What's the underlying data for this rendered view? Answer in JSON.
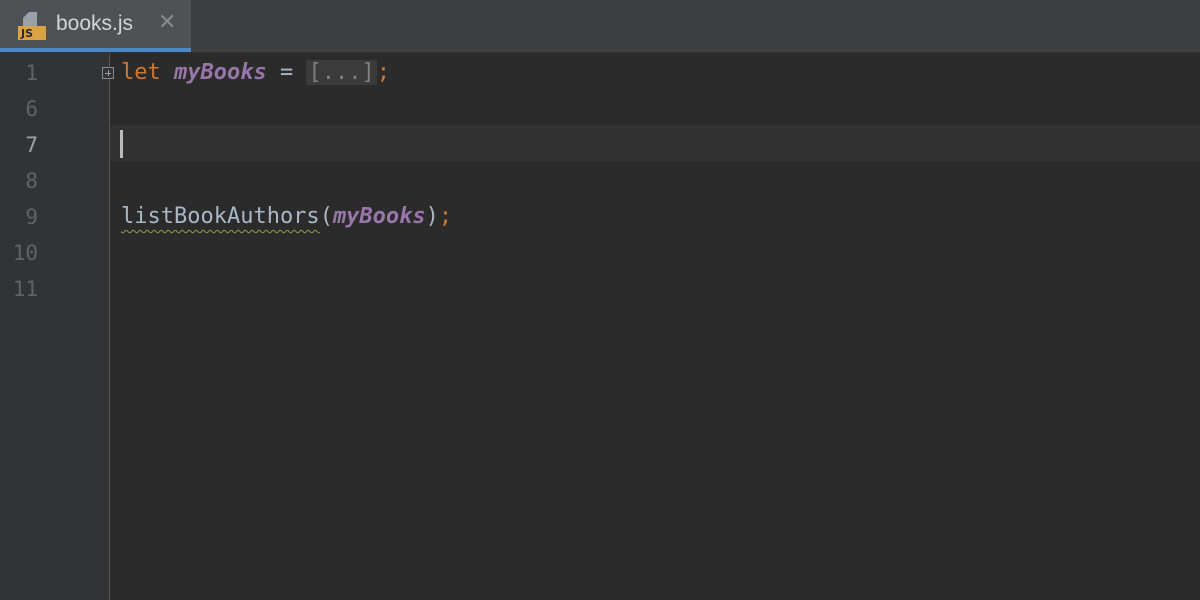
{
  "tab": {
    "title": "books.js",
    "icon_label": "JS",
    "close_glyph": "✕",
    "active_indicator_color": "#4a88c7"
  },
  "editor": {
    "line_numbers": [
      "1",
      "6",
      "7",
      "8",
      "9",
      "10",
      "11"
    ],
    "current_line": "7",
    "lines": {
      "line1": {
        "keyword": "let",
        "variable": "myBooks",
        "operator": "=",
        "folded": "[...]",
        "semicolon": ";"
      },
      "line9": {
        "function": "listBookAuthors",
        "open_paren": "(",
        "argument": "myBooks",
        "close_paren": ")",
        "semicolon": ";"
      }
    }
  },
  "colors": {
    "background": "#2b2b2b",
    "keyword": "#cc7832",
    "variable": "#9876aa",
    "text": "#a9b7c6"
  }
}
